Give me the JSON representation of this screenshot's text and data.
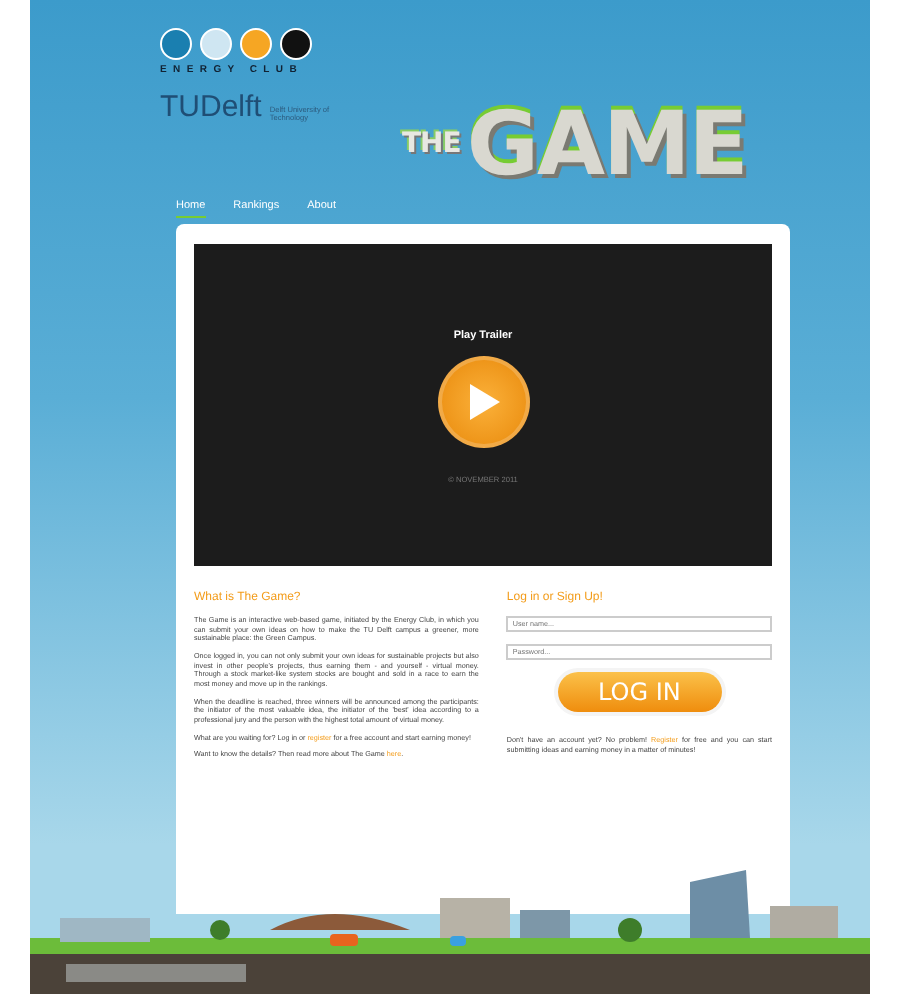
{
  "header": {
    "club_name": "ENERGY CLUB",
    "university": "TUDelft",
    "university_subtitle": "Delft University of Technology",
    "game_logo": [
      "THE",
      "GAME"
    ]
  },
  "nav": [
    {
      "label": "Home",
      "selected": true
    },
    {
      "label": "Rankings",
      "selected": false
    },
    {
      "label": "About",
      "selected": false
    }
  ],
  "video": {
    "overlay_title": "Play Trailer",
    "caption": "© NOVEMBER 2011"
  },
  "about": {
    "heading": "What is The Game?",
    "paragraphs": [
      [
        {
          "text": "The Game is an interactive web-based game, initiated by the Energy Club, in which you can submit your own ideas on how to make the TU Delft campus a greener, more sustainable place: the Green Campus.",
          "link": false
        }
      ],
      [
        {
          "text": "Once logged in, you can not only submit your own ideas for sustainable projects but also invest in other people's projects, thus earning them - and yourself - virtual money. Through a stock market-like system stocks are bought and sold in a race to earn the most money and move up in the rankings.",
          "link": false
        }
      ],
      [
        {
          "text": "When the deadline is reached, three winners will be announced among the participants: the initiator of the most valuable idea, the initiator of the 'best' idea according to a professional jury and the person with the highest total amount of virtual money.",
          "link": false
        }
      ],
      [
        {
          "text": "What are you waiting for? Log in or ",
          "link": false
        },
        {
          "text": "register",
          "link": true
        },
        {
          "text": " for a free account and start earning money!",
          "link": false
        }
      ],
      [
        {
          "text": "Want to know the details? Then read more about The Game ",
          "link": false
        },
        {
          "text": "here",
          "link": true
        },
        {
          "text": ".",
          "link": false
        }
      ]
    ]
  },
  "login": {
    "heading": "Log in or Sign Up!",
    "username": {
      "placeholder": "User name..."
    },
    "password": {
      "placeholder": "Password..."
    },
    "button": "LOG IN",
    "note": [
      {
        "text": "Don't have an account yet? No problem! ",
        "link": false
      },
      {
        "text": "Register",
        "link": true
      },
      {
        "text": " for free and you can start submitting ideas and earning money in a matter of minutes!",
        "link": false
      }
    ]
  }
}
